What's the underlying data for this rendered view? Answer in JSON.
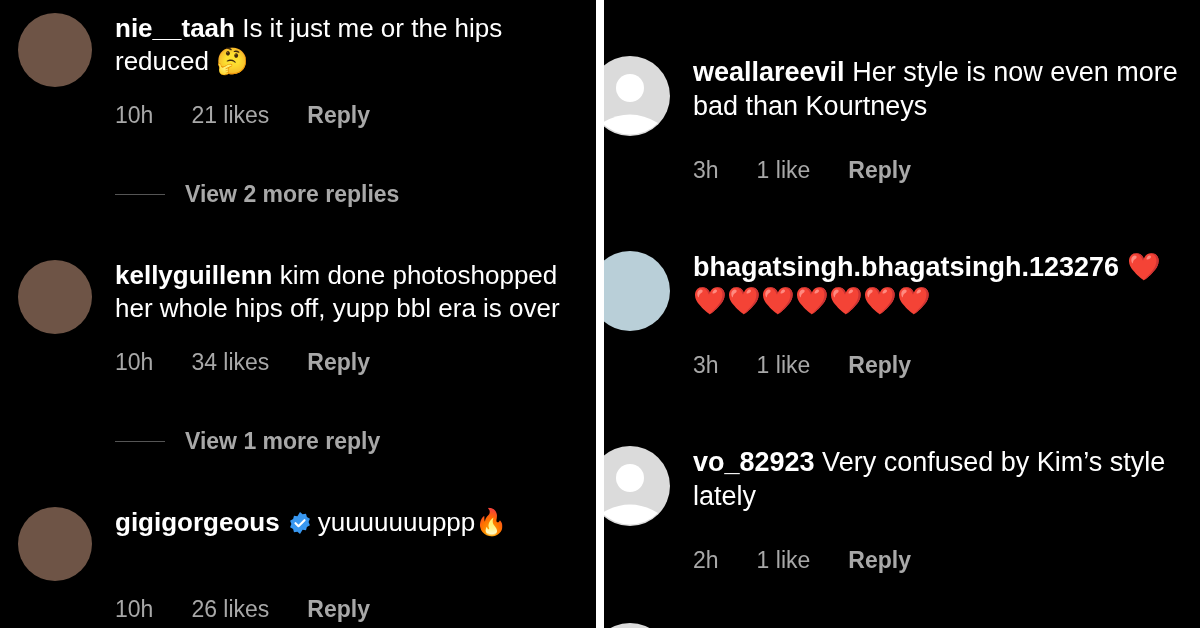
{
  "panels": [
    {
      "comments": [
        {
          "kind": "photo",
          "username": "nie__taah",
          "verified": false,
          "text": "Is it just me or the hips reduced 🤔",
          "time": "10h",
          "likes": "21 likes",
          "reply": "Reply",
          "more_replies": "View 2 more replies"
        },
        {
          "kind": "photo",
          "username": "kellyguillenn",
          "verified": false,
          "text": "kim done photoshopped her whole hips off, yupp bbl era is over",
          "time": "10h",
          "likes": "34 likes",
          "reply": "Reply",
          "more_replies": "View 1 more reply"
        },
        {
          "kind": "photo",
          "username": "gigigorgeous",
          "verified": true,
          "text": "yuuuuuuuppp🔥",
          "time": "10h",
          "likes": "26 likes",
          "reply": "Reply"
        }
      ]
    },
    {
      "comments": [
        {
          "kind": "default",
          "username": "weallareevil",
          "verified": false,
          "text": "Her style is now even more bad than Kourtneys",
          "time": "3h",
          "likes": "1 like",
          "reply": "Reply"
        },
        {
          "kind": "photo",
          "username": "bhagatsingh.bhagatsingh.123276",
          "verified": false,
          "text": "❤️❤️❤️❤️❤️❤️❤️❤️",
          "time": "3h",
          "likes": "1 like",
          "reply": "Reply"
        },
        {
          "kind": "default",
          "username": "vo_82923",
          "verified": false,
          "text": "Very confused by Kim’s style lately",
          "time": "2h",
          "likes": "1 like",
          "reply": "Reply"
        }
      ]
    }
  ]
}
